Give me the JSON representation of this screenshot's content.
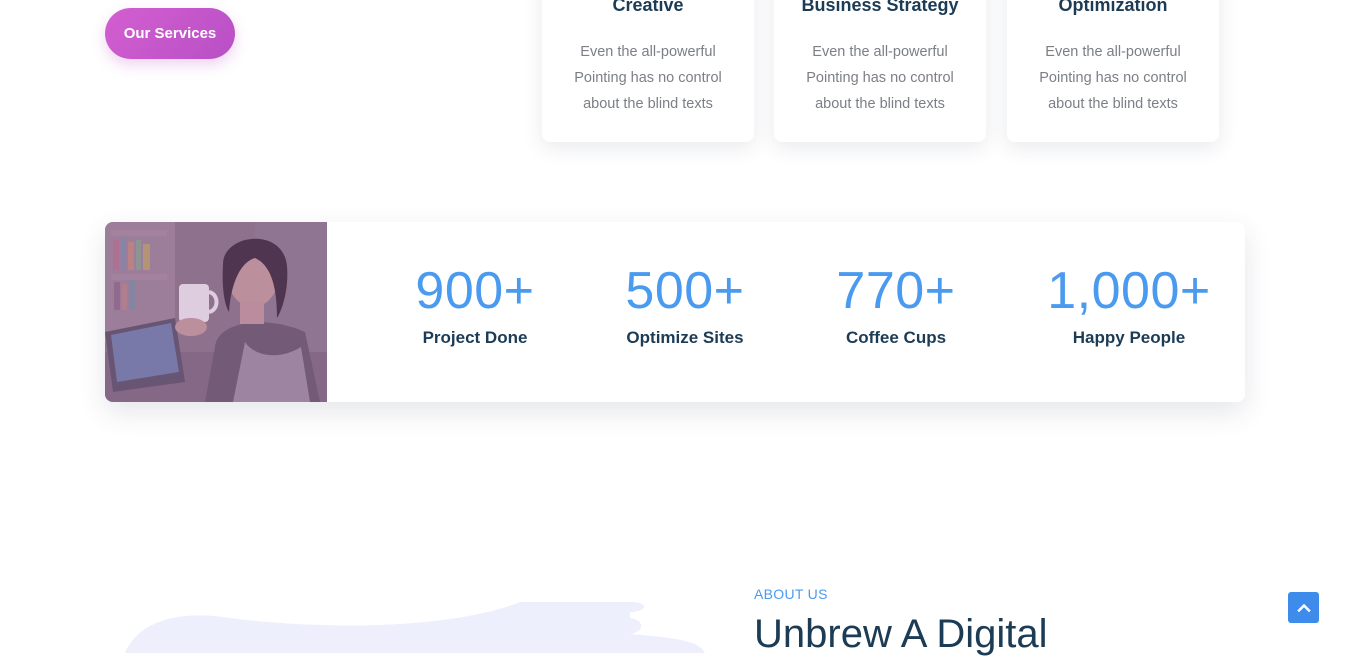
{
  "services_button": {
    "label": "Our Services"
  },
  "cards": [
    {
      "title": "Creative",
      "text": "Even the all-powerful Pointing has no control about the blind texts"
    },
    {
      "title": "Business Strategy",
      "text": "Even the all-powerful Pointing has no control about the blind texts"
    },
    {
      "title": "Optimization",
      "text": "Even the all-powerful Pointing has no control about the blind texts"
    }
  ],
  "stats": [
    {
      "number": "900+",
      "label": "Project Done"
    },
    {
      "number": "500+",
      "label": "Optimize Sites"
    },
    {
      "number": "770+",
      "label": "Coffee Cups"
    },
    {
      "number": "1,000+",
      "label": "Happy People"
    }
  ],
  "about": {
    "eyebrow": "ABOUT US",
    "heading": "Unbrew A Digital"
  },
  "colors": {
    "accent_blue": "#4a9bef",
    "brand_purple": "#c356cb",
    "heading": "#1c3b55",
    "body_text": "#7b7f86",
    "blob": "#eeeffc"
  },
  "icons": {
    "scroll_top": "chevron-up-icon"
  }
}
